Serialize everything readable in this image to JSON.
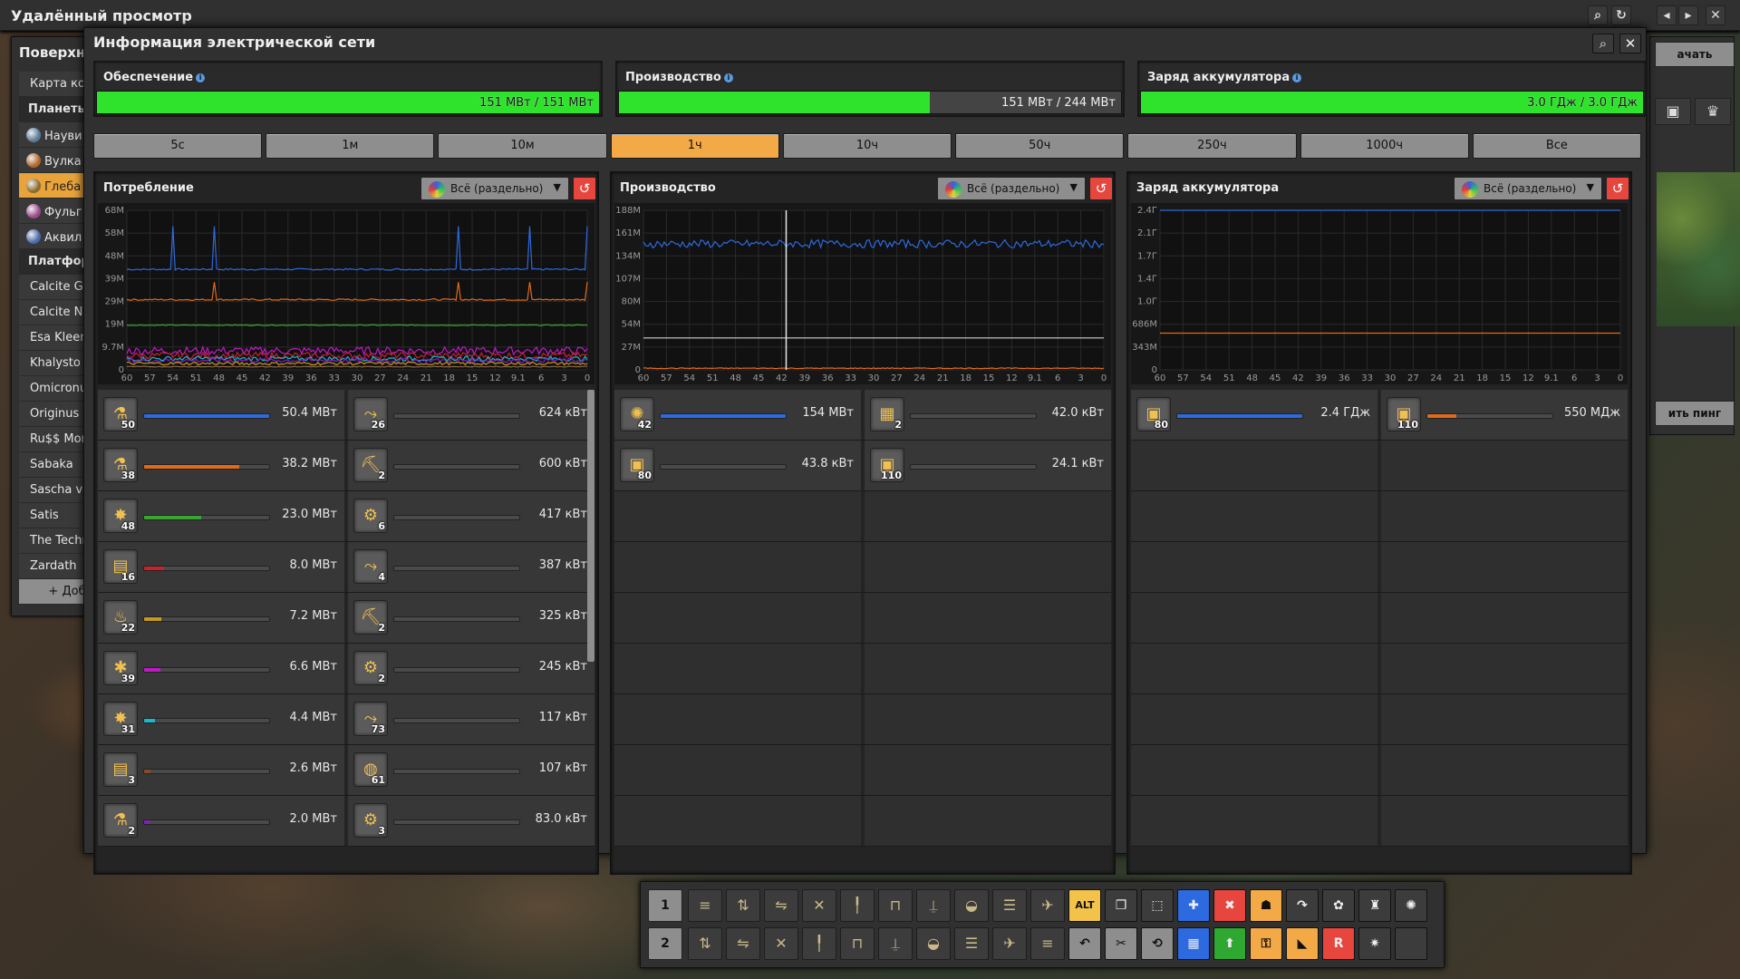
{
  "remote": {
    "title": "Удалённый просмотр",
    "left_header": "Поверхн",
    "left_items": [
      {
        "label": "Карта кос",
        "kind": "item"
      },
      {
        "label": "Планеты",
        "kind": "head"
      },
      {
        "label": "Науви",
        "kind": "planet",
        "color": "#5a7a9a"
      },
      {
        "label": "Вулка",
        "kind": "planet",
        "color": "#b0662a"
      },
      {
        "label": "Глеба",
        "kind": "planet-sel",
        "color": "#8a6a2a"
      },
      {
        "label": "Фульг",
        "kind": "planet",
        "color": "#9a4a8a"
      },
      {
        "label": "Аквил",
        "kind": "planet",
        "color": "#4a6aaa"
      },
      {
        "label": "Платфор",
        "kind": "head"
      },
      {
        "label": "Calcite Gle",
        "kind": "item"
      },
      {
        "label": "Calcite Na",
        "kind": "item"
      },
      {
        "label": "Esa Kleem",
        "kind": "item"
      },
      {
        "label": "Khalysto",
        "kind": "item"
      },
      {
        "label": "Omicronus",
        "kind": "item"
      },
      {
        "label": "Originus",
        "kind": "item"
      },
      {
        "label": "Ru$$ Mor",
        "kind": "item"
      },
      {
        "label": "Sabaka",
        "kind": "item"
      },
      {
        "label": "Sascha va",
        "kind": "item"
      },
      {
        "label": "Satis",
        "kind": "item"
      },
      {
        "label": "The Techn",
        "kind": "item"
      },
      {
        "label": "Zardath",
        "kind": "item"
      },
      {
        "label": "+ Доб",
        "kind": "add"
      }
    ],
    "right_start_label": "ачать",
    "right_ping_label": "ить пинг"
  },
  "window": {
    "title": "Информация электрической сети",
    "stats": [
      {
        "label": "Обеспечение",
        "value": "151 МВт / 151 МВт",
        "fill": 1.0
      },
      {
        "label": "Производство",
        "value": "151 МВт / 244 МВт",
        "fill": 0.619
      },
      {
        "label": "Заряд аккумулятора",
        "value": "3.0 ГДж / 3.0 ГДж",
        "fill": 1.0
      }
    ],
    "time_tabs": [
      "5с",
      "1м",
      "10м",
      "1ч",
      "10ч",
      "50ч",
      "250ч",
      "1000ч",
      "Все"
    ],
    "selected_tab": "1ч",
    "dropdown_label": "Всё (раздельно)"
  },
  "graphs": [
    {
      "title": "Потребление",
      "y_ticks": [
        "68M",
        "58M",
        "48M",
        "39M",
        "29M",
        "19M",
        "9.7M",
        "0"
      ],
      "x_ticks": [
        "60",
        "57",
        "54",
        "51",
        "48",
        "45",
        "42",
        "39",
        "36",
        "33",
        "30",
        "27",
        "24",
        "21",
        "18",
        "15",
        "12",
        "9.1",
        "6",
        "3",
        "0"
      ]
    },
    {
      "title": "Производство",
      "y_ticks": [
        "188M",
        "161M",
        "134M",
        "107M",
        "80M",
        "54M",
        "27M",
        "0"
      ],
      "x_ticks": [
        "60",
        "57",
        "54",
        "51",
        "48",
        "45",
        "42",
        "39",
        "36",
        "33",
        "30",
        "27",
        "24",
        "21",
        "18",
        "15",
        "12",
        "9.1",
        "6",
        "3",
        "0"
      ]
    },
    {
      "title": "Заряд аккумулятора",
      "y_ticks": [
        "2.4Г",
        "2.1Г",
        "1.7Г",
        "1.4Г",
        "1.0Г",
        "686M",
        "343M",
        "0"
      ],
      "x_ticks": [
        "60",
        "57",
        "54",
        "51",
        "48",
        "45",
        "42",
        "39",
        "36",
        "33",
        "30",
        "27",
        "24",
        "21",
        "18",
        "15",
        "12",
        "9.1",
        "6",
        "3",
        "0"
      ]
    }
  ],
  "consumption_rows": [
    [
      {
        "count": "50",
        "value": "50.4 МВт",
        "fill": 1.0,
        "color": "#2d6ae0",
        "icon": "lab-icon"
      },
      {
        "count": "26",
        "value": "624 кВт",
        "fill": 0.0,
        "color": "#888",
        "icon": "inserter-icon"
      }
    ],
    [
      {
        "count": "38",
        "value": "38.2 МВт",
        "fill": 0.76,
        "color": "#e06a1c",
        "icon": "lab-icon"
      },
      {
        "count": "2",
        "value": "600 кВт",
        "fill": 0.0,
        "color": "#888",
        "icon": "drill-icon"
      }
    ],
    [
      {
        "count": "48",
        "value": "23.0 МВт",
        "fill": 0.46,
        "color": "#3aa632",
        "icon": "turret-icon"
      },
      {
        "count": "6",
        "value": "417 кВт",
        "fill": 0.0,
        "color": "#888",
        "icon": "assembler-icon"
      }
    ],
    [
      {
        "count": "16",
        "value": "8.0 МВт",
        "fill": 0.16,
        "color": "#c8222a",
        "icon": "factory-icon"
      },
      {
        "count": "4",
        "value": "387 кВт",
        "fill": 0.0,
        "color": "#888",
        "icon": "inserter-icon"
      }
    ],
    [
      {
        "count": "22",
        "value": "7.2 МВт",
        "fill": 0.14,
        "color": "#c89a1c",
        "icon": "furnace-icon"
      },
      {
        "count": "2",
        "value": "325 кВт",
        "fill": 0.0,
        "color": "#888",
        "icon": "drill-icon"
      }
    ],
    [
      {
        "count": "39",
        "value": "6.6 МВт",
        "fill": 0.13,
        "color": "#c01ac8",
        "icon": "beacon-icon"
      },
      {
        "count": "2",
        "value": "245 кВт",
        "fill": 0.0,
        "color": "#888",
        "icon": "assembler-icon"
      }
    ],
    [
      {
        "count": "31",
        "value": "4.4 МВт",
        "fill": 0.09,
        "color": "#1ab8c8",
        "icon": "turret-icon"
      },
      {
        "count": "73",
        "value": "117 кВт",
        "fill": 0.0,
        "color": "#888",
        "icon": "inserter-icon"
      }
    ],
    [
      {
        "count": "3",
        "value": "2.6 МВт",
        "fill": 0.05,
        "color": "#8a4a2a",
        "icon": "factory-icon"
      },
      {
        "count": "61",
        "value": "107 кВт",
        "fill": 0.0,
        "color": "#888",
        "icon": "radar-icon"
      }
    ],
    [
      {
        "count": "2",
        "value": "2.0 МВт",
        "fill": 0.04,
        "color": "#8a1ac8",
        "icon": "lab-icon"
      },
      {
        "count": "3",
        "value": "83.0 кВт",
        "fill": 0.0,
        "color": "#888",
        "icon": "assembler-icon"
      }
    ]
  ],
  "production_rows": [
    [
      {
        "count": "42",
        "value": "154 МВт",
        "fill": 1.0,
        "color": "#2d6ae0",
        "icon": "generator-icon"
      },
      {
        "count": "2",
        "value": "42.0 кВт",
        "fill": 0.0,
        "color": "#888",
        "icon": "solar-panel-icon"
      }
    ],
    [
      {
        "count": "80",
        "value": "43.8 кВт",
        "fill": 0.0,
        "color": "#888",
        "icon": "accumulator-icon"
      },
      {
        "count": "110",
        "value": "24.1 кВт",
        "fill": 0.0,
        "color": "#888",
        "icon": "accumulator-icon"
      }
    ]
  ],
  "accumulator_rows": [
    [
      {
        "count": "80",
        "value": "2.4 ГДж",
        "fill": 1.0,
        "color": "#2d6ae0",
        "icon": "accumulator-icon"
      },
      {
        "count": "110",
        "value": "550 МДж",
        "fill": 0.23,
        "color": "#e06a1c",
        "icon": "accumulator-icon"
      }
    ]
  ],
  "quickbar": {
    "row_numbers": [
      "1",
      "2"
    ],
    "alt_label": "ALT"
  },
  "colors": {
    "accent": "#f3a945",
    "ok": "#2fe32c",
    "danger": "#e6463e",
    "panel": "#313031"
  }
}
